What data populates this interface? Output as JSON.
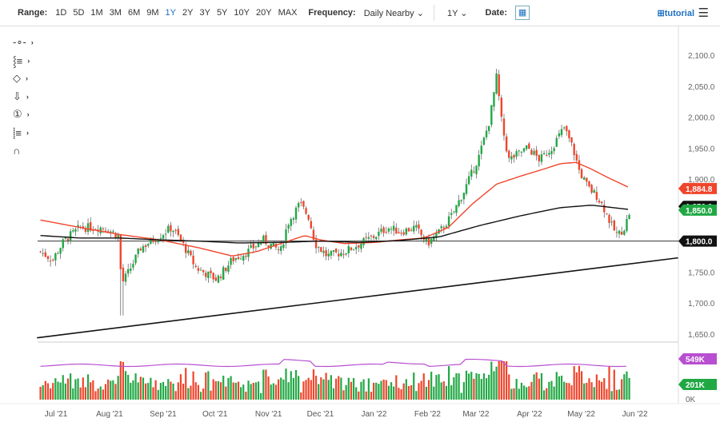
{
  "toolbar": {
    "range_label": "Range:",
    "ranges": [
      "1D",
      "5D",
      "1M",
      "3M",
      "6M",
      "9M",
      "1Y",
      "2Y",
      "3Y",
      "5Y",
      "10Y",
      "20Y",
      "MAX"
    ],
    "active_range": "1Y",
    "frequency_label": "Frequency:",
    "frequency_value": "Daily Nearby",
    "period_value": "1Y",
    "date_label": "Date:",
    "tutorial": "tutorial"
  },
  "tools": [
    "line-tool-icon",
    "fib-tool-icon",
    "shape-tool-icon",
    "arrow-tool-icon",
    "annotation-tool-icon",
    "indicator-tool-icon",
    "magnet-tool-icon"
  ],
  "colors": {
    "up": "#21a845",
    "down": "#f0452c",
    "ma50": "#f0452c",
    "ma200": "#111111",
    "oi": "#b84fd0",
    "trend": "#111111"
  },
  "chart_data": {
    "type": "candlestick",
    "x_unit": "days since 2021-07-01",
    "x_ticks": [
      {
        "d": 0,
        "label": "Jul '21"
      },
      {
        "d": 31,
        "label": "Aug '21"
      },
      {
        "d": 62,
        "label": "Sep '21"
      },
      {
        "d": 92,
        "label": "Oct '21"
      },
      {
        "d": 123,
        "label": "Nov '21"
      },
      {
        "d": 153,
        "label": "Dec '21"
      },
      {
        "d": 184,
        "label": "Jan '22"
      },
      {
        "d": 215,
        "label": "Feb '22"
      },
      {
        "d": 243,
        "label": "Mar '22"
      },
      {
        "d": 274,
        "label": "Apr '22"
      },
      {
        "d": 304,
        "label": "May '22"
      },
      {
        "d": 335,
        "label": "Jun '22"
      }
    ],
    "y_ticks": [
      "2,100.0",
      "2,050.0",
      "2,000.0",
      "1,950.0",
      "1,900.0",
      "1,850.0",
      "1,800.0",
      "1,750.0",
      "1,700.0",
      "1,650.0"
    ],
    "ylim": [
      1650,
      2100
    ],
    "close_keypoints": [
      [
        -9,
        1783
      ],
      [
        -2,
        1770
      ],
      [
        5,
        1802
      ],
      [
        14,
        1822
      ],
      [
        28,
        1822
      ],
      [
        36,
        1809
      ],
      [
        38,
        1731
      ],
      [
        42,
        1750
      ],
      [
        49,
        1789
      ],
      [
        60,
        1809
      ],
      [
        67,
        1822
      ],
      [
        72,
        1802
      ],
      [
        81,
        1757
      ],
      [
        93,
        1738
      ],
      [
        102,
        1770
      ],
      [
        111,
        1783
      ],
      [
        120,
        1802
      ],
      [
        130,
        1783
      ],
      [
        134,
        1828
      ],
      [
        141,
        1860
      ],
      [
        146,
        1841
      ],
      [
        150,
        1796
      ],
      [
        157,
        1776
      ],
      [
        167,
        1783
      ],
      [
        176,
        1796
      ],
      [
        185,
        1809
      ],
      [
        192,
        1822
      ],
      [
        199,
        1815
      ],
      [
        208,
        1822
      ],
      [
        215,
        1796
      ],
      [
        222,
        1815
      ],
      [
        229,
        1841
      ],
      [
        236,
        1880
      ],
      [
        241,
        1912
      ],
      [
        245,
        1938
      ],
      [
        251,
        1996
      ],
      [
        255,
        2066
      ],
      [
        258,
        1989
      ],
      [
        262,
        1931
      ],
      [
        266,
        1938
      ],
      [
        273,
        1951
      ],
      [
        280,
        1931
      ],
      [
        287,
        1951
      ],
      [
        294,
        1983
      ],
      [
        299,
        1951
      ],
      [
        303,
        1912
      ],
      [
        308,
        1886
      ],
      [
        313,
        1873
      ],
      [
        317,
        1854
      ],
      [
        322,
        1822
      ],
      [
        325,
        1809
      ],
      [
        329,
        1822
      ],
      [
        332,
        1847
      ]
    ],
    "ma50": [
      [
        -9,
        1834
      ],
      [
        14,
        1822
      ],
      [
        36,
        1811
      ],
      [
        60,
        1802
      ],
      [
        83,
        1789
      ],
      [
        102,
        1776
      ],
      [
        116,
        1783
      ],
      [
        130,
        1796
      ],
      [
        144,
        1809
      ],
      [
        153,
        1802
      ],
      [
        167,
        1796
      ],
      [
        185,
        1798
      ],
      [
        199,
        1802
      ],
      [
        213,
        1805
      ],
      [
        227,
        1822
      ],
      [
        241,
        1860
      ],
      [
        255,
        1892
      ],
      [
        269,
        1905
      ],
      [
        282,
        1916
      ],
      [
        292,
        1925
      ],
      [
        301,
        1927
      ],
      [
        310,
        1916
      ],
      [
        319,
        1903
      ],
      [
        332,
        1886
      ]
    ],
    "ma200": [
      [
        -9,
        1809
      ],
      [
        14,
        1805
      ],
      [
        37,
        1805
      ],
      [
        60,
        1802
      ],
      [
        83,
        1800
      ],
      [
        106,
        1797
      ],
      [
        130,
        1798
      ],
      [
        153,
        1800
      ],
      [
        176,
        1798
      ],
      [
        199,
        1801
      ],
      [
        222,
        1807
      ],
      [
        245,
        1825
      ],
      [
        269,
        1841
      ],
      [
        292,
        1854
      ],
      [
        310,
        1858
      ],
      [
        332,
        1851
      ]
    ],
    "flash_low": 1680,
    "peak_high": 2078,
    "trendline": [
      [
        -11,
        1644
      ],
      [
        360,
        1773
      ]
    ],
    "hline": 1800,
    "labels": {
      "ma50": "1,884.8",
      "last": "1,850.0",
      "hline": "1,800.0",
      "oi": "549K",
      "volume": "201K",
      "vol_zero": "0K"
    }
  }
}
